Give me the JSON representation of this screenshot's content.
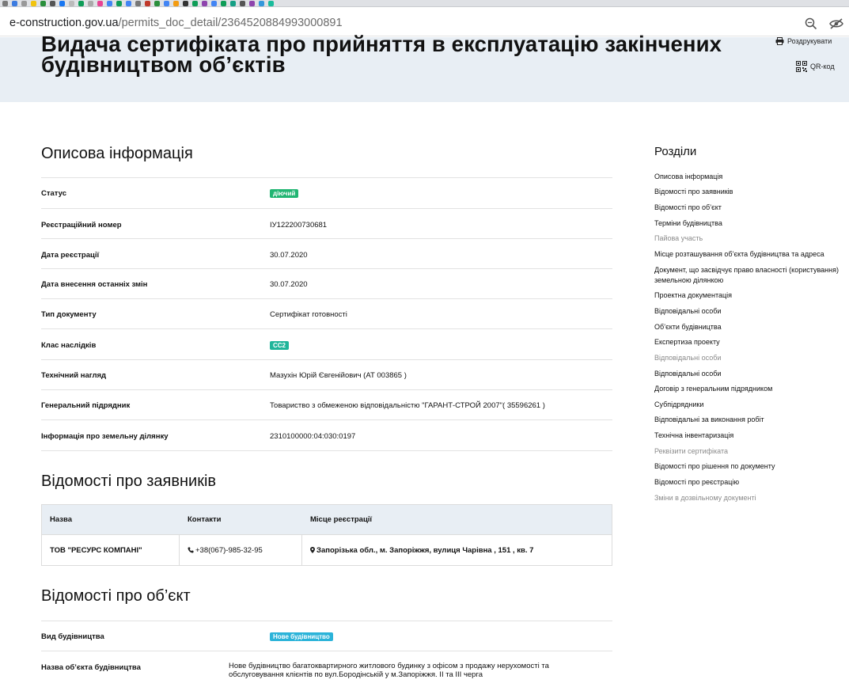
{
  "browser": {
    "url_domain": "e-construction.gov.ua",
    "url_path": "/permits_doc_detail/2364520884993000891"
  },
  "header": {
    "title": "Видача сертифіката про прийняття в експлуатацію закінчених будівництвом об’єктів",
    "print_label": "Роздрукувати",
    "qr_label": "QR-код"
  },
  "sections": {
    "desc_title": "Описова інформація",
    "applicants_title": "Відомості про заявників",
    "object_title": "Відомості про об’єкт"
  },
  "desc": {
    "status_label": "Статус",
    "status_value": "діючий",
    "reg_number_label": "Реєстраційний номер",
    "reg_number_value": "ІУ122200730681",
    "reg_date_label": "Дата реєстрації",
    "reg_date_value": "30.07.2020",
    "last_change_label": "Дата внесення останніх змін",
    "last_change_value": "30.07.2020",
    "doc_type_label": "Тип документу",
    "doc_type_value": "Сертифікат готовності",
    "class_label": "Клас наслідків",
    "class_value": "СС2",
    "supervision_label": "Технічний нагляд",
    "supervision_value": "Мазухін Юрій Євгенійович (АТ 003865 )",
    "contractor_label": "Генеральний підрядник",
    "contractor_value": "Товариство з обмеженою відповідальністю \"ГАРАНТ-СТРОЙ 2007\"( 35596261 )",
    "land_label": "Інформація про земельну ділянку",
    "land_value": "2310100000:04:030:0197"
  },
  "applicants": {
    "col_name": "Назва",
    "col_contacts": "Контакти",
    "col_registration": "Місце реєстрації",
    "rows": [
      {
        "name": "ТОВ \"РЕСУРС КОМПАНІ\"",
        "phone": "+38(067)-985-32-95",
        "address": "Запорізька обл., м. Запоріжжя, вулиця Чарівна , 151 , кв. 7"
      }
    ]
  },
  "object": {
    "build_type_label": "Вид будівництва",
    "build_type_value": "Нове будівництво",
    "object_name_label": "Назва об’єкта будівництва",
    "object_name_value": "Нове будівництво багатоквартирного житлового будинку з офісом з продажу нерухомості та обслуговування клієнтів по вул.Бородінській у м.Запоріжжя. ІІ та ІІІ черга"
  },
  "sidebar": {
    "title": "Розділи",
    "items": [
      {
        "label": "Описова інформація",
        "muted": false
      },
      {
        "label": "Відомості про заявників",
        "muted": false
      },
      {
        "label": "Відомості про об’єкт",
        "muted": false
      },
      {
        "label": "Терміни будівництва",
        "muted": false
      },
      {
        "label": "Пайова участь",
        "muted": true
      },
      {
        "label": "Місце розташування об’єкта будівництва та адреса",
        "muted": false
      },
      {
        "label": "Документ, що засвідчує право власності (користування) земельною ділянкою",
        "muted": false
      },
      {
        "label": "Проектна документація",
        "muted": false
      },
      {
        "label": "Відповідальні особи",
        "muted": false
      },
      {
        "label": "Об’єкти будівництва",
        "muted": false
      },
      {
        "label": "Експертиза проекту",
        "muted": false
      },
      {
        "label": "Відповідальні особи",
        "muted": true
      },
      {
        "label": "Відповідальні особи",
        "muted": false
      },
      {
        "label": "Договір з генеральним підрядником",
        "muted": false
      },
      {
        "label": "Субпідрядники",
        "muted": false
      },
      {
        "label": "Відповідальні за виконання робіт",
        "muted": false
      },
      {
        "label": "Технічна інвентаризація",
        "muted": false
      },
      {
        "label": "Реквізити сертифіката",
        "muted": true
      },
      {
        "label": "Відомості про рішення по документу",
        "muted": false
      },
      {
        "label": "Відомості про реєстрацію",
        "muted": false
      },
      {
        "label": "Зміни в дозвільному документі",
        "muted": true
      }
    ]
  },
  "colors": {
    "status_badge": "#22b573",
    "class_badge": "#1fb59a",
    "build_badge": "#2bb3d9",
    "header_band": "#e8eef4"
  }
}
